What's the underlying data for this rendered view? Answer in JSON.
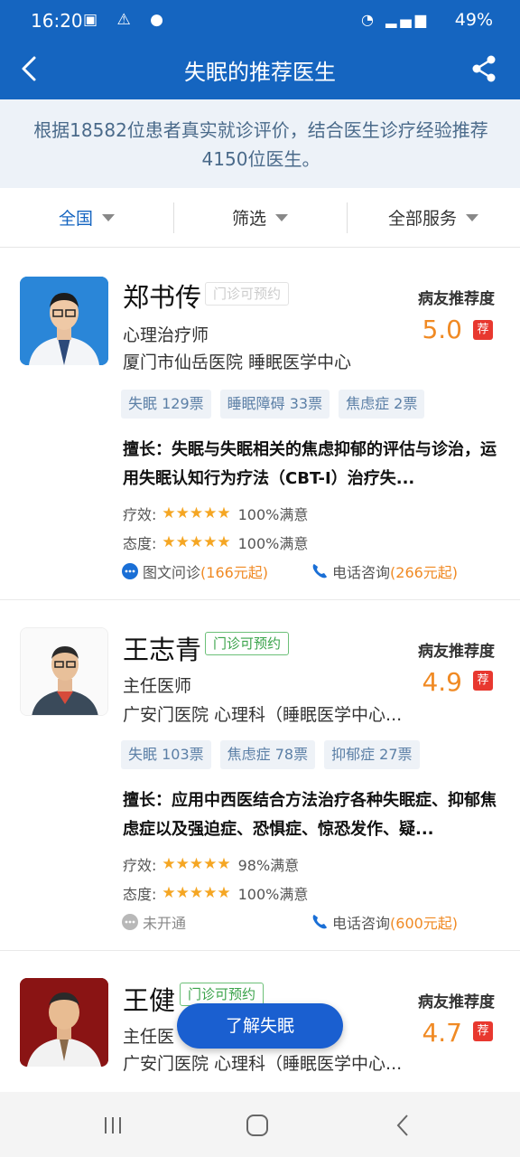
{
  "status_bar": {
    "time": "16:20",
    "battery": "49%"
  },
  "header": {
    "title": "失眠的推荐医生"
  },
  "summary": {
    "text": "根据18582位患者真实就诊评价，结合医生诊疗经验推荐4150位医生。"
  },
  "filters": [
    {
      "label": "全国"
    },
    {
      "label": "筛选"
    },
    {
      "label": "全部服务"
    }
  ],
  "recommend_label": "病友推荐度",
  "rec_tag": "荐",
  "efficacy_label": "疗效:",
  "attitude_label": "态度:",
  "doctors": [
    {
      "name": "郑书传",
      "badge": "门诊可预约",
      "title": "心理治疗师",
      "hospital": "厦门市仙岳医院 睡眠医学中心",
      "score": "5.0",
      "tags": [
        "失眠 129票",
        "睡眠障碍 33票",
        "焦虑症 2票"
      ],
      "skill": "擅长：失眠与失眠相关的焦虑抑郁的评估与诊治，运用失眠认知行为疗法（CBT-I）治疗失...",
      "efficacy_stars": 5,
      "efficacy": "100%满意",
      "attitude_stars": 5,
      "attitude": "100%满意",
      "text_consult": "图文问诊",
      "text_consult_price": "(166元起)",
      "phone_consult": "电话咨询",
      "phone_consult_price": "(266元起)"
    },
    {
      "name": "王志青",
      "badge": "门诊可预约",
      "title": "主任医师",
      "hospital": "广安门医院 心理科（睡眠医学中心...",
      "score": "4.9",
      "tags": [
        "失眠 103票",
        "焦虑症 78票",
        "抑郁症 27票"
      ],
      "skill": "擅长：应用中西医结合方法治疗各种失眠症、抑郁焦虑症以及强迫症、恐惧症、惊恐发作、疑...",
      "efficacy_stars": 5,
      "efficacy": "98%满意",
      "attitude_stars": 5,
      "attitude": "100%满意",
      "text_consult": "未开通",
      "phone_consult": "电话咨询",
      "phone_consult_price": "(600元起)"
    },
    {
      "name": "王健",
      "badge": "门诊可预约",
      "title": "主任医",
      "hospital": "广安门医院 心理科（睡眠医学中心...",
      "score": "4.7"
    }
  ],
  "fab": {
    "label": "了解失眠"
  },
  "colors": {
    "primary": "#1565c0",
    "accent": "#f08a24",
    "tag_red": "#e8382f",
    "badge_green": "#3aa34a"
  }
}
